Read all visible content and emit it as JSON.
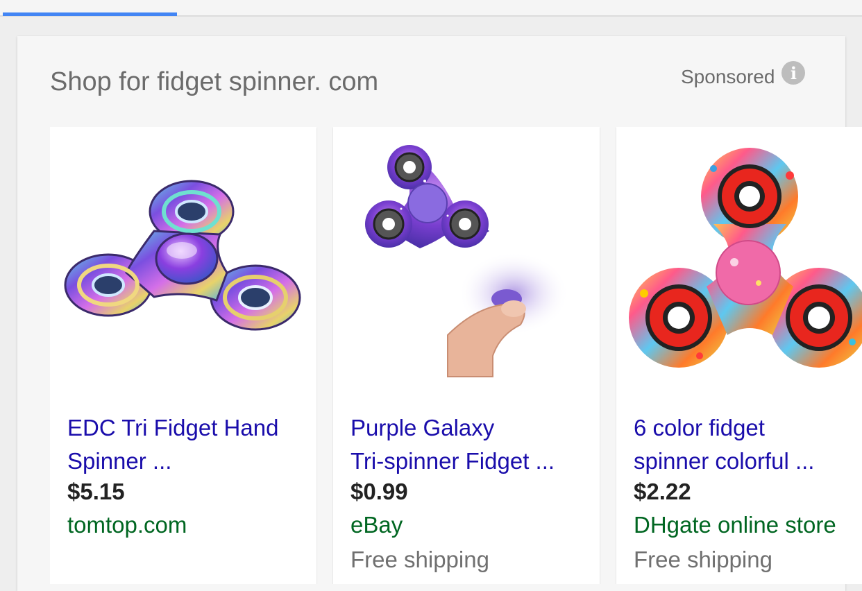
{
  "header": {
    "title": "Shop for fidget spinner. com",
    "sponsored_label": "Sponsored"
  },
  "colors": {
    "accent": "#4285f4",
    "link": "#1a0dab",
    "store": "#006621",
    "muted": "#6b6b6b"
  },
  "products": [
    {
      "title_line1": "EDC Tri Fidget Hand",
      "title_line2": "Spinner ...",
      "price": "$5.15",
      "store": "tomtop.com",
      "shipping": ""
    },
    {
      "title_line1": "Purple Galaxy",
      "title_line2": "Tri-spinner Fidget ...",
      "price": "$0.99",
      "store": "eBay",
      "shipping": "Free shipping"
    },
    {
      "title_line1": "6 color fidget",
      "title_line2": "spinner colorful ...",
      "price": "$2.22",
      "store": "DHgate online store",
      "shipping": "Free shipping"
    }
  ]
}
